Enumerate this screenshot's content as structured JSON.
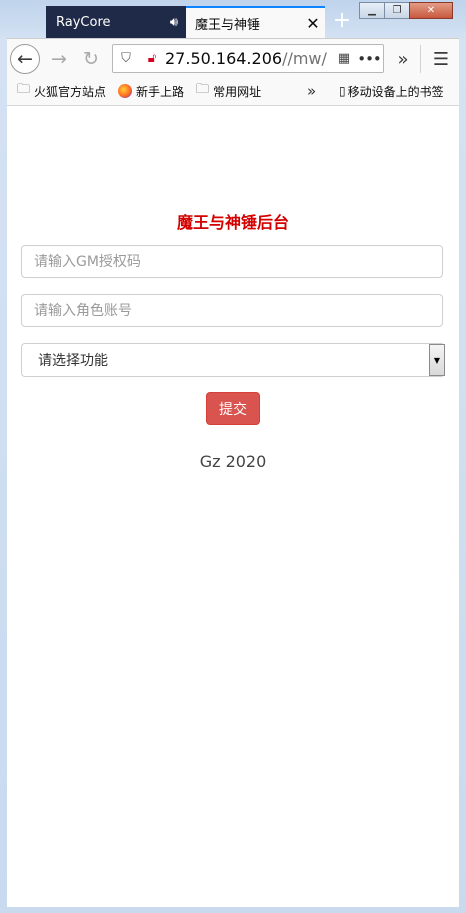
{
  "browser": {
    "tabs": [
      {
        "label": "RayCore",
        "icon": "speaker-icon",
        "active": false
      },
      {
        "label": "魔王与神锤",
        "icon": "close-icon",
        "active": true
      }
    ],
    "new_tab_icon": "+",
    "url": {
      "host": "27.50.164.206",
      "path": "//mw/"
    },
    "bookmarks": [
      {
        "label": "火狐官方站点",
        "icon": "folder-icon"
      },
      {
        "label": "新手上路",
        "icon": "firefox-icon"
      },
      {
        "label": "常用网址",
        "icon": "folder-icon"
      }
    ],
    "mobile_bookmarks": "移动设备上的书签"
  },
  "page": {
    "title": "魔王与神锤后台",
    "gm_code_placeholder": "请输入GM授权码",
    "account_placeholder": "请输入角色账号",
    "function_select": {
      "selected": "请选择功能"
    },
    "submit_label": "提交",
    "footer": "Gz 2020"
  },
  "colors": {
    "accent": "#d40000",
    "button": "#d9534f"
  }
}
